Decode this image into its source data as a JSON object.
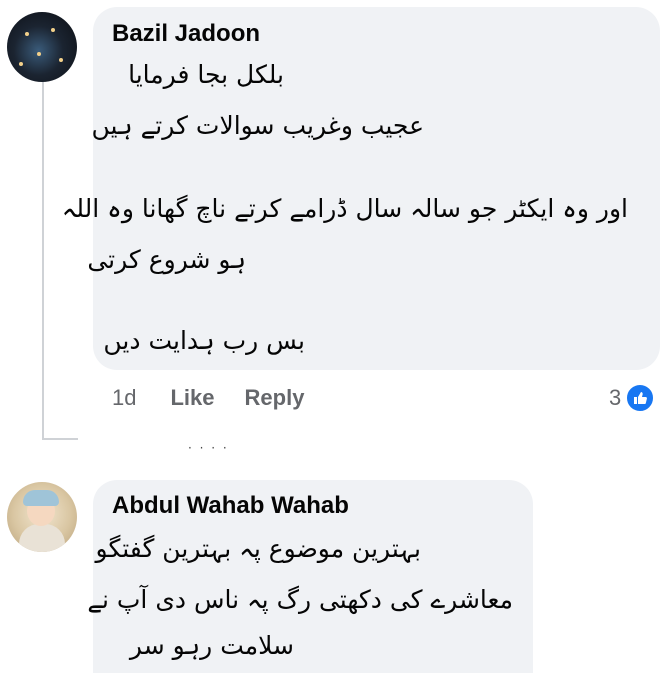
{
  "comments": [
    {
      "author": "Bazil Jadoon",
      "lines": [
        "بلکل بجا فرمایا",
        "عجیب وغریب سوالات کرتے ہیں",
        "اور وہ ایکٹر جو سالہ سال ڈرامے کرتے ناچ گھانا وہ اللہ",
        "ہو شروع کرتی",
        "بس رب ہدایت دیں"
      ],
      "time": "1d",
      "like_label": "Like",
      "reply_label": "Reply",
      "reaction_count": "3",
      "reaction_icon": "thumbs-up-icon"
    },
    {
      "author": "Abdul Wahab Wahab",
      "lines": [
        "بہترین موضوع پہ بہترین گفتگو",
        "معاشرے کی دکھتی رگ پہ ناس دی آپ نے",
        "سلامت رہو سر"
      ]
    }
  ],
  "colors": {
    "bubble": "#f0f2f5",
    "meta_text": "#65676b",
    "like_blue": "#1877f2",
    "thread_line": "#cfd2d6"
  },
  "more_indicator": "· · · ·"
}
